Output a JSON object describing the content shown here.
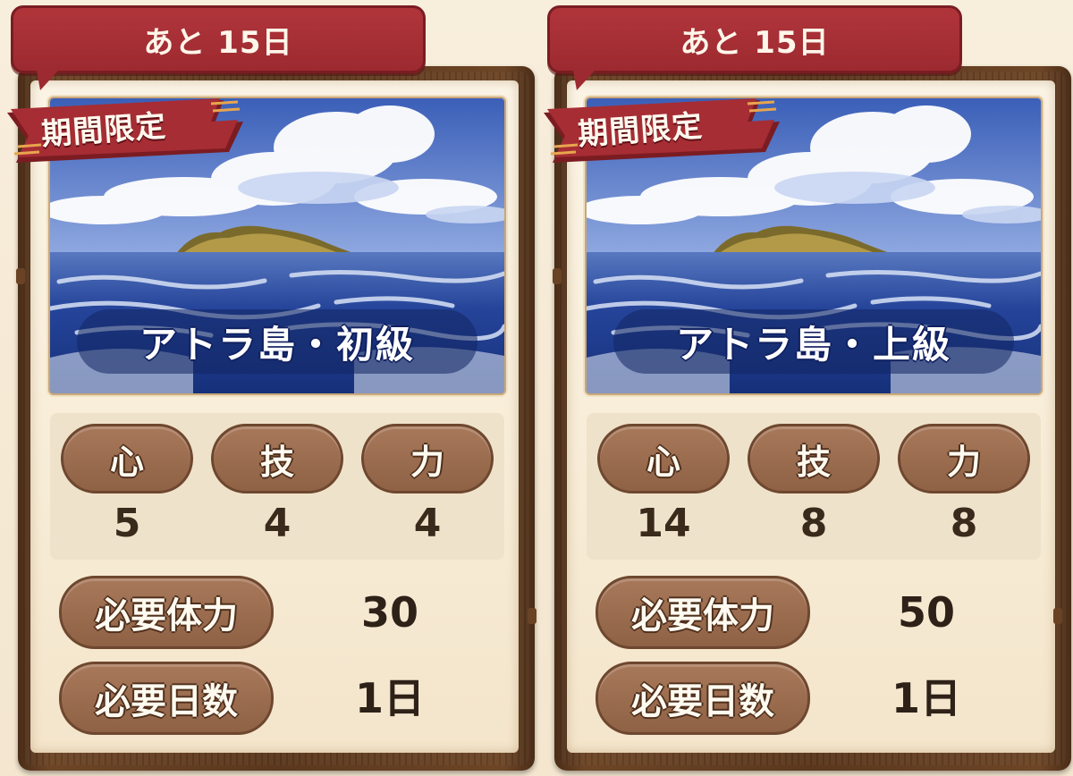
{
  "cards": [
    {
      "deadline": "あと 15日",
      "badge": "期間限定",
      "stage_name": "アトラ島・初級",
      "stats": [
        {
          "label": "心",
          "value": "5"
        },
        {
          "label": "技",
          "value": "4"
        },
        {
          "label": "力",
          "value": "4"
        }
      ],
      "requirements": [
        {
          "label": "必要体力",
          "value": "30"
        },
        {
          "label": "必要日数",
          "value": "1日"
        }
      ]
    },
    {
      "deadline": "あと 15日",
      "badge": "期間限定",
      "stage_name": "アトラ島・上級",
      "stats": [
        {
          "label": "心",
          "value": "14"
        },
        {
          "label": "技",
          "value": "8"
        },
        {
          "label": "力",
          "value": "8"
        }
      ],
      "requirements": [
        {
          "label": "必要体力",
          "value": "50"
        },
        {
          "label": "必要日数",
          "value": "1日"
        }
      ]
    }
  ],
  "colors": {
    "deadline_bg": "#9c2a30",
    "ribbon": "#a62d34",
    "pill": "#8f6245",
    "frame": "#5a371d",
    "paper": "#f7ecd6",
    "sea": "#1d3a86",
    "sky": "#4f72c6"
  },
  "icons": {
    "scene": "island-sea-illustration",
    "badge": "ribbon-banner"
  }
}
